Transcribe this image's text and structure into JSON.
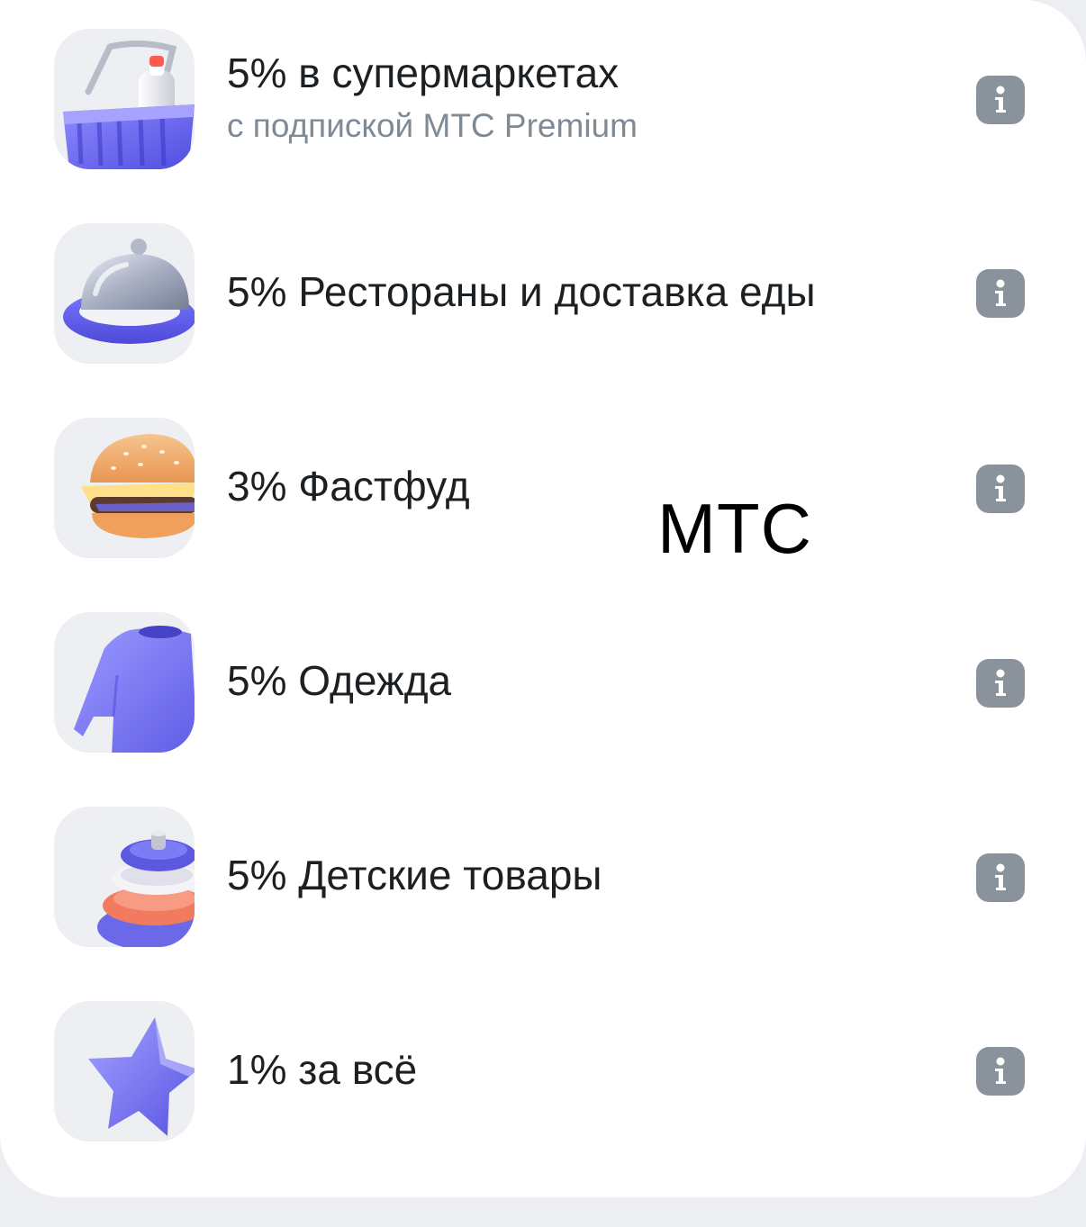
{
  "watermark": "МТС",
  "colors": {
    "card_background": "#ffffff",
    "page_background": "#eceef2",
    "title_text": "#1d2023",
    "subtitle_text": "#7f8a96",
    "info_button": "#8a939b",
    "icon_accent": "#6e6cf2"
  },
  "cashback": {
    "items": [
      {
        "icon": "shopping-basket-icon",
        "title": "5% в супермаркетах",
        "subtitle": "с подпиской МТС Premium",
        "info_icon": "info-icon"
      },
      {
        "icon": "food-cloche-icon",
        "title": "5% Рестораны и доставка еды",
        "info_icon": "info-icon"
      },
      {
        "icon": "burger-icon",
        "title": "3% Фастфуд",
        "info_icon": "info-icon"
      },
      {
        "icon": "tshirt-icon",
        "title": "5% Одежда",
        "info_icon": "info-icon"
      },
      {
        "icon": "stacking-rings-toy-icon",
        "title": "5% Детские товары",
        "info_icon": "info-icon"
      },
      {
        "icon": "star-icon",
        "title": "1% за всё",
        "info_icon": "info-icon"
      }
    ]
  }
}
